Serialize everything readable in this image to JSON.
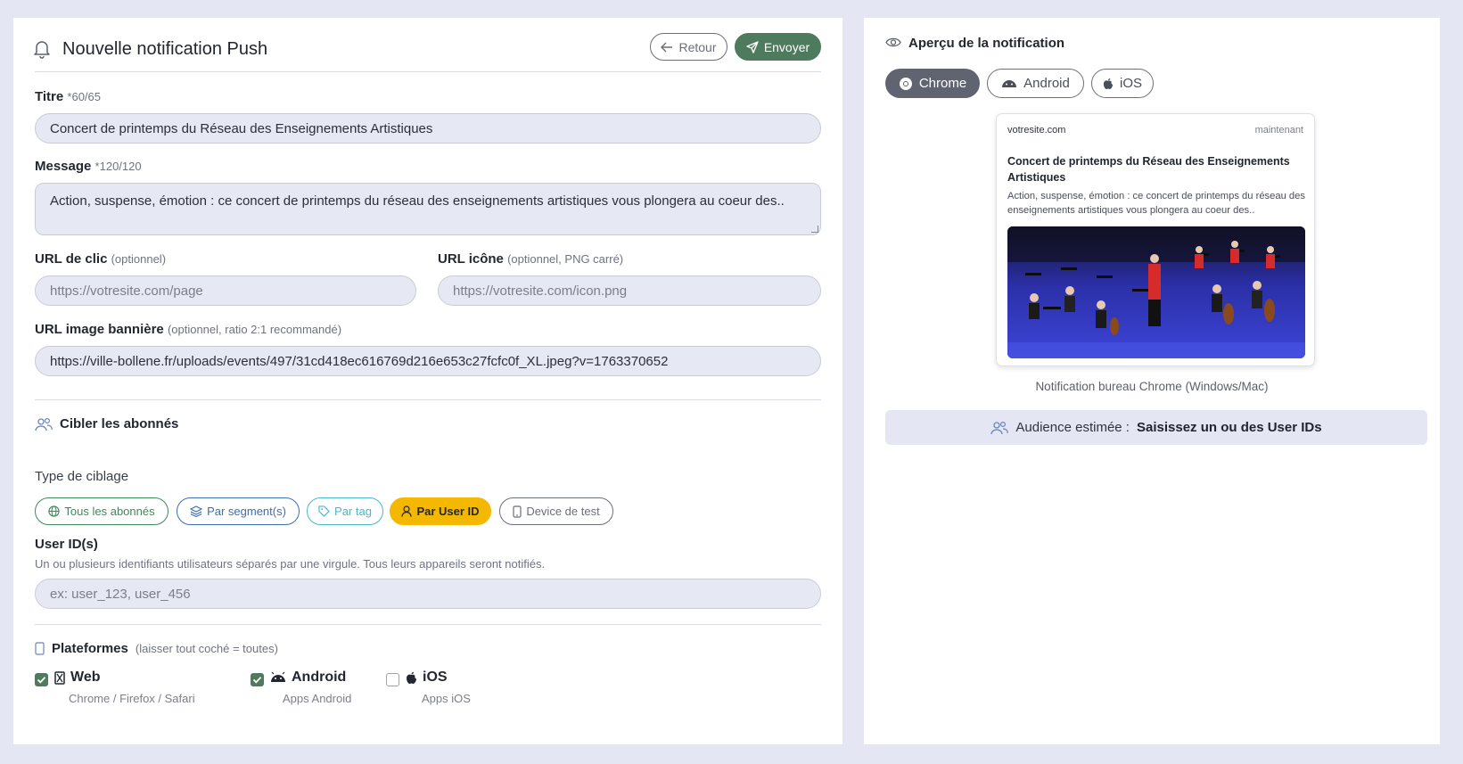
{
  "header": {
    "title": "Nouvelle notification Push",
    "back_label": "Retour",
    "send_label": "Envoyer"
  },
  "title_field": {
    "label": "Titre",
    "required": "*",
    "counter": "60/65",
    "value": "Concert de printemps du Réseau des Enseignements Artistiques"
  },
  "message_field": {
    "label": "Message",
    "required": "*",
    "counter": "120/120",
    "value": "Action, suspense, émotion : ce concert de printemps du réseau des enseignements artistiques vous plongera au coeur des.."
  },
  "click_url": {
    "label": "URL de clic",
    "hint": "(optionnel)",
    "placeholder": "https://votresite.com/page"
  },
  "icon_url": {
    "label": "URL icône",
    "hint": "(optionnel, PNG carré)",
    "placeholder": "https://votresite.com/icon.png"
  },
  "banner_url": {
    "label": "URL image bannière",
    "hint": "(optionnel, ratio 2:1 recommandé)",
    "value": "https://ville-bollene.fr/uploads/events/497/31cd418ec616769d216e653c27fcfc0f_XL.jpeg?v=1763370652"
  },
  "targeting": {
    "section_title": "Cibler les abonnés",
    "type_label": "Type de ciblage",
    "options": [
      {
        "label": "Tous les abonnés",
        "color": "#3f8a5a",
        "icon": "globe-icon"
      },
      {
        "label": "Par segment(s)",
        "color": "#3b6fb0",
        "icon": "layers-icon"
      },
      {
        "label": "Par tag",
        "color": "#49b8c8",
        "icon": "tag-icon"
      },
      {
        "label": "Par User ID",
        "color": "#f5b800",
        "icon": "user-icon",
        "selected": true
      },
      {
        "label": "Device de test",
        "color": "#6b6f78",
        "icon": "device-icon"
      }
    ],
    "userid_label": "User ID(s)",
    "userid_help": "Un ou plusieurs identifiants utilisateurs séparés par une virgule. Tous leurs appareils seront notifiés.",
    "userid_placeholder": "ex: user_123, user_456"
  },
  "platforms": {
    "section_title": "Plateformes",
    "hint": "(laisser tout coché = toutes)",
    "items": [
      {
        "name": "Web",
        "sub": "Chrome / Firefox / Safari",
        "checked": true,
        "icon": "web-icon"
      },
      {
        "name": "Android",
        "sub": "Apps Android",
        "checked": true,
        "icon": "android-icon"
      },
      {
        "name": "iOS",
        "sub": "Apps iOS",
        "checked": false,
        "icon": "apple-icon"
      }
    ]
  },
  "preview": {
    "title": "Aperçu de la notification",
    "tabs": [
      {
        "label": "Chrome",
        "active": true
      },
      {
        "label": "Android",
        "active": false
      },
      {
        "label": "iOS",
        "active": false
      }
    ],
    "card": {
      "site": "votresite.com",
      "time": "maintenant",
      "title": "Concert de printemps du Réseau des Enseignements Artistiques",
      "message": "Action, suspense, émotion : ce concert de printemps du réseau des enseignements artistiques vous plongera au coeur des.."
    },
    "caption": "Notification bureau Chrome (Windows/Mac)",
    "audience_label": "Audience estimée :",
    "audience_value": "Saisissez un ou des User IDs"
  },
  "colors": {
    "accent_green": "#4e7a5d",
    "background": "#e4e6f3",
    "field_bg": "#e6e8f4",
    "selected_chip": "#f5b800"
  }
}
